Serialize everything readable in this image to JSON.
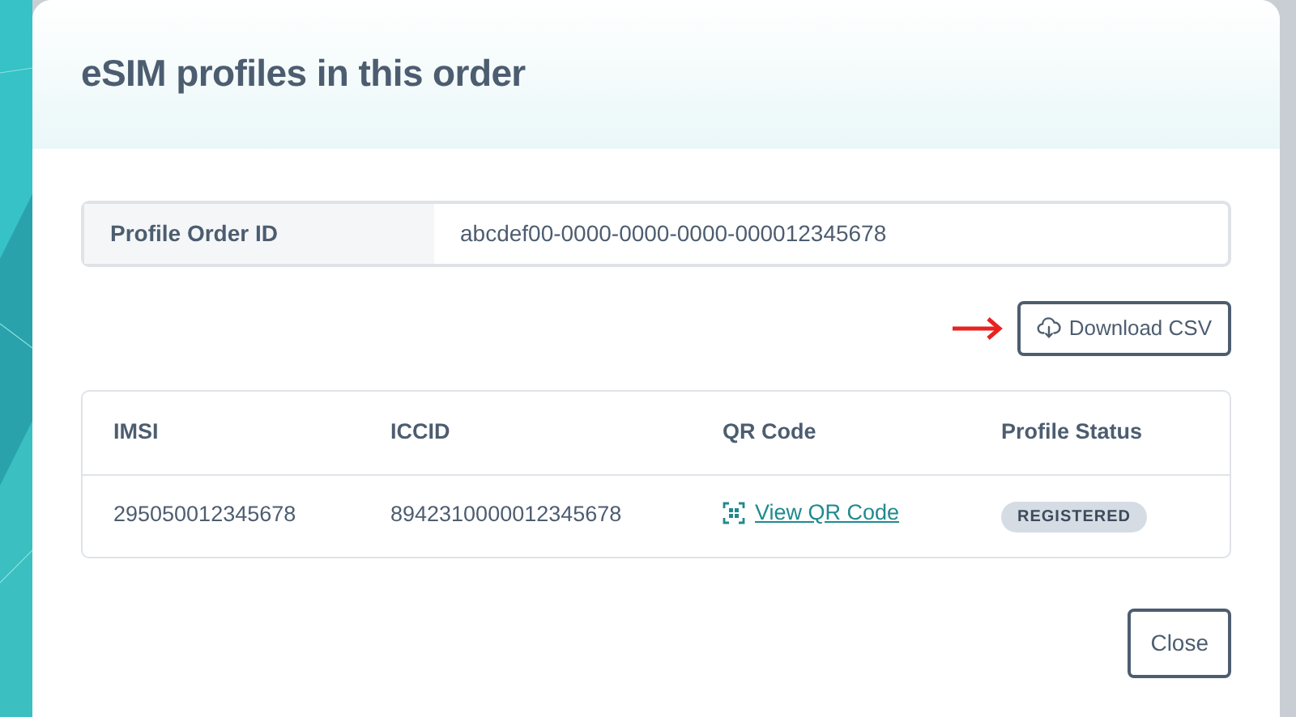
{
  "dialog": {
    "title": "eSIM profiles in this order"
  },
  "order": {
    "label": "Profile Order ID",
    "value": "abcdef00-0000-0000-0000-000012345678"
  },
  "download_button": {
    "label": "Download CSV"
  },
  "table": {
    "columns": [
      "IMSI",
      "ICCID",
      "QR Code",
      "Profile Status"
    ],
    "rows": [
      {
        "imsi": "295050012345678",
        "iccid": "8942310000012345678",
        "qr_link": "View QR Code",
        "status": "REGISTERED"
      }
    ]
  },
  "close_button": {
    "label": "Close"
  }
}
